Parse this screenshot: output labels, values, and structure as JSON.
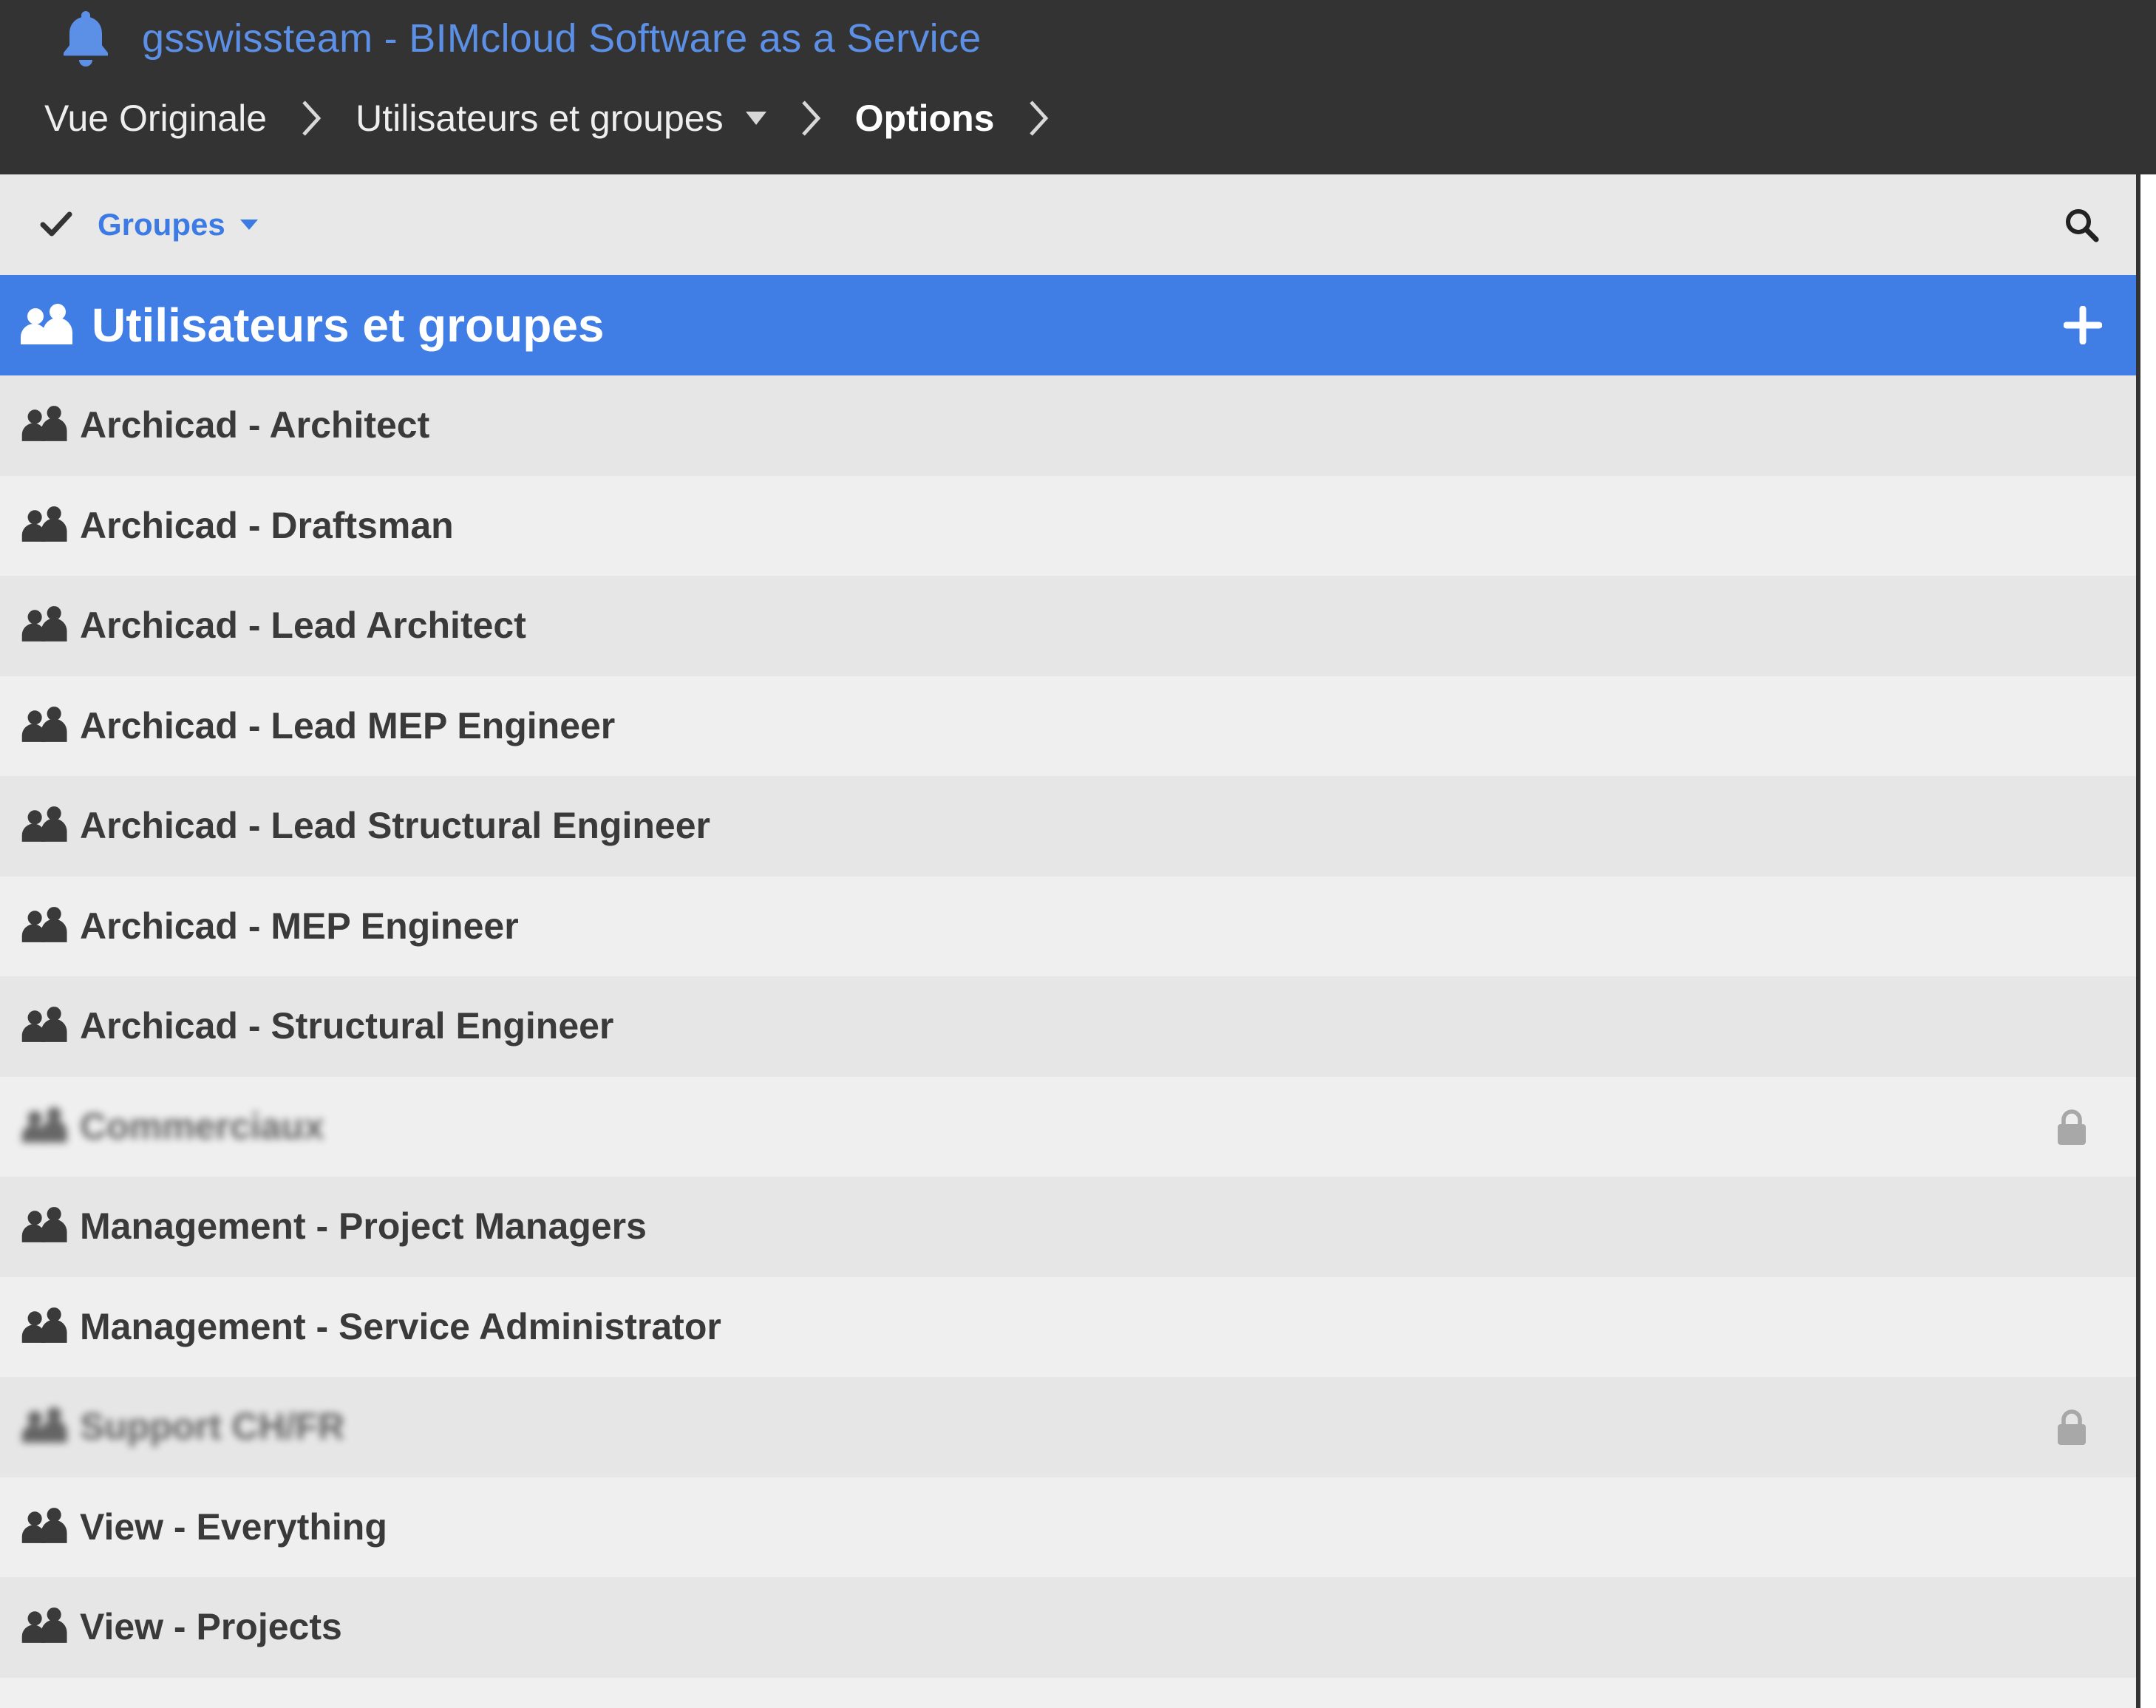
{
  "app": {
    "title": "gsswissteam - BIMcloud Software as a Service",
    "bell_icon": "bell-icon"
  },
  "breadcrumb": {
    "items": [
      "Vue Originale",
      "Utilisateurs et groupes",
      "Options"
    ],
    "separator_icon": "chevron-right-icon",
    "dropdown_icon": "caret-down-icon"
  },
  "toolbar": {
    "check_icon": "check-icon",
    "filter_label": "Groupes",
    "filter_icon": "caret-down-icon",
    "search_icon": "search-icon"
  },
  "panel": {
    "title": "Utilisateurs et groupes",
    "title_icon": "users-group-icon",
    "add_icon": "plus-icon"
  },
  "groups": [
    {
      "label": "Archicad - Architect",
      "locked": false
    },
    {
      "label": "Archicad - Draftsman",
      "locked": false
    },
    {
      "label": "Archicad - Lead Architect",
      "locked": false
    },
    {
      "label": "Archicad - Lead MEP Engineer",
      "locked": false
    },
    {
      "label": "Archicad - Lead Structural Engineer",
      "locked": false
    },
    {
      "label": "Archicad - MEP Engineer",
      "locked": false
    },
    {
      "label": "Archicad - Structural Engineer",
      "locked": false
    },
    {
      "label": "Commerciaux",
      "locked": true
    },
    {
      "label": "Management - Project Managers",
      "locked": false
    },
    {
      "label": "Management - Service Administrator",
      "locked": false
    },
    {
      "label": "Support CH/FR",
      "locked": true
    },
    {
      "label": "View - Everything",
      "locked": false
    },
    {
      "label": "View - Projects",
      "locked": false
    }
  ],
  "colors": {
    "topbar": "#333333",
    "accent": "#407ee6",
    "link": "#5c8fe6",
    "row_text": "#3a3a3a"
  }
}
